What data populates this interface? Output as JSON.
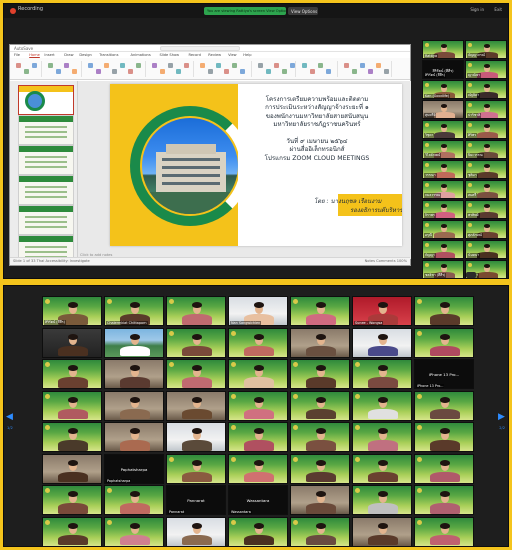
{
  "top_window": {
    "recording_label": "Recording",
    "share_banner": "You are viewing Rattiya's screen  View Options",
    "view_options": "View Options",
    "sign_in": "Sign in",
    "exit": "Exit",
    "ppt": {
      "autosave": "AutoSave",
      "menu_tabs": [
        "File",
        "Home",
        "Insert",
        "Draw",
        "Design",
        "Transitions",
        "Animations",
        "Slide Show",
        "Record",
        "Review",
        "View",
        "Help"
      ],
      "status_left": "Slide 1 of 33   Thai   Accessibility: Investigate",
      "status_right": "Notes   Comments   100%",
      "notes_placeholder": "Click to add notes"
    },
    "slide": {
      "lines": [
        "โครงการเตรียมความพร้อมและติดตาม",
        "การประเมินระหว่างสัญญาจ้างระยะที่ ๑",
        "ของพนักงานมหาวิทยาลัยสายสนับสนุน",
        "มหาวิทยาลัยราชภัฏราชนครินทร์",
        "",
        "วันที่ ๙ เมษายน ๒๕๖๔",
        "ผ่านสื่ออิเล็กทรอนิกส์",
        "โปรแกรม ZOOM CLOUD MEETINGS"
      ],
      "by_line1": "โดย : นางนฤชล  เรือนงาม",
      "by_line2": "รองอธิการบดีบริหาร"
    },
    "side_gallery": [
      {
        "name": "Rattiya",
        "kind": "green",
        "person": "#7a4a3a"
      },
      {
        "name": "ธัญญาภรณ์",
        "kind": "green",
        "person": "#5c3a2a"
      },
      {
        "name": "สิริรัตน์ (สีสีร)",
        "kind": "dark-text",
        "label": "สิริรัตน์ (สีสีร)"
      },
      {
        "name": "ญาณิษา",
        "kind": "green",
        "person": "#c85a7a"
      },
      {
        "name": "Kan (Goodlife)",
        "kind": "green",
        "person": "#8a5a3a"
      },
      {
        "name": "ณัฐธิดา",
        "kind": "green",
        "person": "#3a2a2a"
      },
      {
        "name": "สุนทรีย์",
        "kind": "room",
        "person": "#e0b090"
      },
      {
        "name": "ปาริชาติ",
        "kind": "green",
        "person": "#d07090"
      },
      {
        "name": "วิชุดา",
        "kind": "green",
        "person": "#4a3a3a"
      },
      {
        "name": "ศิริพร",
        "kind": "green",
        "person": "#9a5a4a"
      },
      {
        "name": "วิไลลักษณ์",
        "kind": "green",
        "person": "#b07060"
      },
      {
        "name": "ปิยะวรรณ",
        "kind": "green",
        "person": "#6a4a3a"
      },
      {
        "name": "วรรณา",
        "kind": "green",
        "person": "#c06a5a"
      },
      {
        "name": "ชุติมา",
        "kind": "green",
        "person": "#5a3a2a"
      },
      {
        "name": "กมลวรรณ",
        "kind": "green",
        "person": "#e0a0a0"
      },
      {
        "name": "สมศรี",
        "kind": "green",
        "person": "#7a5040"
      },
      {
        "name": "จิราพร",
        "kind": "green",
        "person": "#d06080"
      },
      {
        "name": "พรทิพย์",
        "kind": "green",
        "person": "#5a3a30"
      },
      {
        "name": "อรุณี",
        "kind": "green",
        "person": "#9a6a50"
      },
      {
        "name": "ศุภลักษณ์",
        "kind": "green",
        "person": "#6a4030"
      },
      {
        "name": "กัญญา",
        "kind": "green",
        "person": "#b05060"
      },
      {
        "name": "นันทนา",
        "kind": "green",
        "person": "#4a3020"
      },
      {
        "name": "ชลธิชา (สีสีร)",
        "kind": "green",
        "person": "#8a5a50"
      },
      {
        "name": "สุพัตรา",
        "kind": "green",
        "person": "#7a4a30"
      }
    ]
  },
  "bottom_window": {
    "page_left": "1/2",
    "page_right": "2/2",
    "tiles": [
      {
        "name": "สิริรัตน์ (สีสีร)",
        "kind": "green",
        "person": "#7a5a3a"
      },
      {
        "name": "Chalermkiat Chittaporn",
        "kind": "green",
        "person": "#5a3a2a"
      },
      {
        "name": "",
        "kind": "green",
        "person": "#c06a70"
      },
      {
        "name": "Nan Sangwichien",
        "kind": "cam",
        "person": "#e8c0a0"
      },
      {
        "name": "",
        "kind": "green",
        "person": "#d06a80"
      },
      {
        "name": "Sunee - Wongsa",
        "kind": "red",
        "person": "#aa3a3a"
      },
      {
        "name": "",
        "kind": "green",
        "person": "#5a3a2a"
      },
      {
        "name": "",
        "kind": "dark-person",
        "person": "#4a3020"
      },
      {
        "name": "",
        "kind": "scenery",
        "person": "#ffffff"
      },
      {
        "name": "",
        "kind": "green",
        "person": "#7a4a3a"
      },
      {
        "name": "",
        "kind": "green",
        "person": "#c06a60"
      },
      {
        "name": "",
        "kind": "room",
        "person": "#6a5040"
      },
      {
        "name": "",
        "kind": "cam",
        "person": "#4a4a8a"
      },
      {
        "name": "",
        "kind": "green",
        "person": "#b04a60"
      },
      {
        "name": "",
        "kind": "green",
        "person": "#6a4030"
      },
      {
        "name": "",
        "kind": "room",
        "person": "#5a3a30"
      },
      {
        "name": "",
        "kind": "green",
        "person": "#c06a70"
      },
      {
        "name": "",
        "kind": "green",
        "person": "#e0c0a0"
      },
      {
        "name": "",
        "kind": "green",
        "person": "#5a3a2a"
      },
      {
        "name": "",
        "kind": "green",
        "person": "#7a4a40"
      },
      {
        "name": "iPhone 13 Pro...",
        "kind": "black-text",
        "label": "iPhone 13 Pro..."
      },
      {
        "name": "",
        "kind": "green",
        "person": "#b05a60"
      },
      {
        "name": "",
        "kind": "room",
        "person": "#8a6a50"
      },
      {
        "name": "",
        "kind": "room",
        "person": "#6a4a30"
      },
      {
        "name": "",
        "kind": "green",
        "person": "#d07080"
      },
      {
        "name": "",
        "kind": "green",
        "person": "#5a4030"
      },
      {
        "name": "",
        "kind": "green",
        "person": "#e0e0e0"
      },
      {
        "name": "",
        "kind": "green",
        "person": "#6a4a40"
      },
      {
        "name": "",
        "kind": "green",
        "person": "#4a3a2a"
      },
      {
        "name": "",
        "kind": "room",
        "person": "#aa6a50"
      },
      {
        "name": "",
        "kind": "cam",
        "person": "#5a4a3a"
      },
      {
        "name": "",
        "kind": "green",
        "person": "#b05060"
      },
      {
        "name": "",
        "kind": "green",
        "person": "#7a5040"
      },
      {
        "name": "",
        "kind": "green",
        "person": "#c07080"
      },
      {
        "name": "",
        "kind": "green",
        "person": "#5a3a2a"
      },
      {
        "name": "",
        "kind": "room",
        "person": "#4a3020"
      },
      {
        "name": "Paphatsharpa",
        "kind": "black-text",
        "label": "Paphatsharpa"
      },
      {
        "name": "",
        "kind": "green",
        "person": "#8a5a40"
      },
      {
        "name": "",
        "kind": "green",
        "person": "#d07070"
      },
      {
        "name": "",
        "kind": "green",
        "person": "#5a3a30"
      },
      {
        "name": "",
        "kind": "green",
        "person": "#6a4030"
      },
      {
        "name": "",
        "kind": "green",
        "person": "#b05a6a"
      },
      {
        "name": "",
        "kind": "green",
        "person": "#7a4a3a"
      },
      {
        "name": "",
        "kind": "green",
        "person": "#c06a60"
      },
      {
        "name": "Pannarat",
        "kind": "black-text",
        "label": "Pannarat"
      },
      {
        "name": "Wassantara",
        "kind": "black-text",
        "label": "Wassantara"
      },
      {
        "name": "",
        "kind": "room",
        "person": "#6a4a3a"
      },
      {
        "name": "",
        "kind": "green",
        "person": "#c0c0c0"
      },
      {
        "name": "",
        "kind": "green",
        "person": "#b06070"
      },
      {
        "name": "",
        "kind": "green",
        "person": "#5a3a2a"
      },
      {
        "name": "",
        "kind": "green",
        "person": "#d08090"
      },
      {
        "name": "",
        "kind": "cam",
        "person": "#8a6a50"
      },
      {
        "name": "",
        "kind": "green",
        "person": "#4a3020"
      },
      {
        "name": "",
        "kind": "green",
        "person": "#6a4a40"
      },
      {
        "name": "",
        "kind": "room",
        "person": "#5a3a2a"
      },
      {
        "name": "",
        "kind": "green",
        "person": "#c06070"
      }
    ]
  },
  "colors": {
    "frame_yellow": "#f4c41c",
    "zoom_dark": "#1e1e1e",
    "green_bg_top": "#2f8a3c",
    "green_bg_bottom": "#c7dd6a",
    "slide_green": "#1a8a4a",
    "slide_yellow": "#f4c21a",
    "zoom_blue": "#2d8cff"
  }
}
